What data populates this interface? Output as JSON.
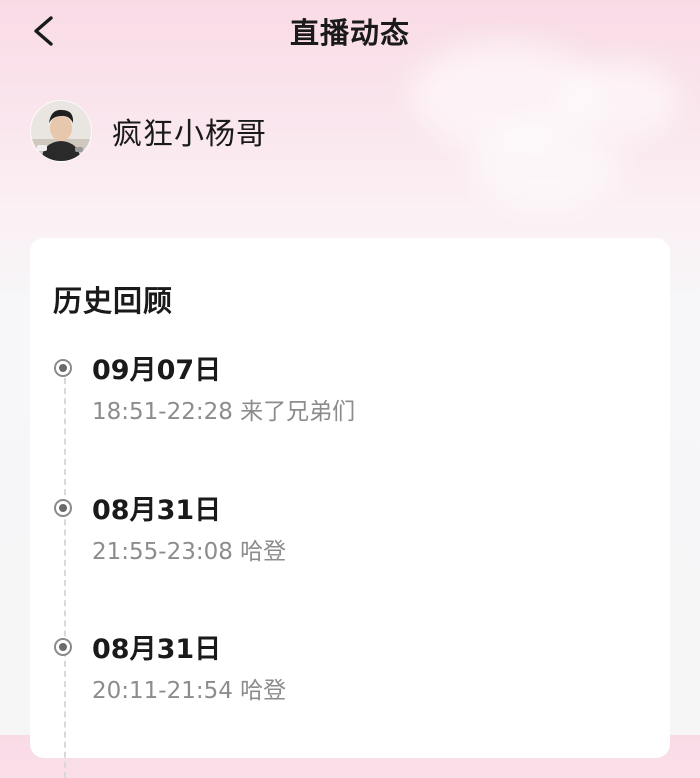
{
  "nav": {
    "title": "直播动态",
    "back_icon": "chevron-left-icon"
  },
  "streamer": {
    "name": "疯狂小杨哥"
  },
  "history": {
    "title": "历史回顾",
    "items": [
      {
        "date": "09月07日",
        "detail": "18:51-22:28 来了兄弟们"
      },
      {
        "date": "08月31日",
        "detail": "21:55-23:08 哈登"
      },
      {
        "date": "08月31日",
        "detail": "20:11-21:54 哈登"
      }
    ]
  },
  "colors": {
    "header_pink": "#f9dbe6",
    "page_bg": "#f6f6f7",
    "card_bg": "#ffffff",
    "primary_text": "#1a1a1a",
    "secondary_text": "#8c8c8c",
    "timeline_line": "#d9d9d9"
  }
}
